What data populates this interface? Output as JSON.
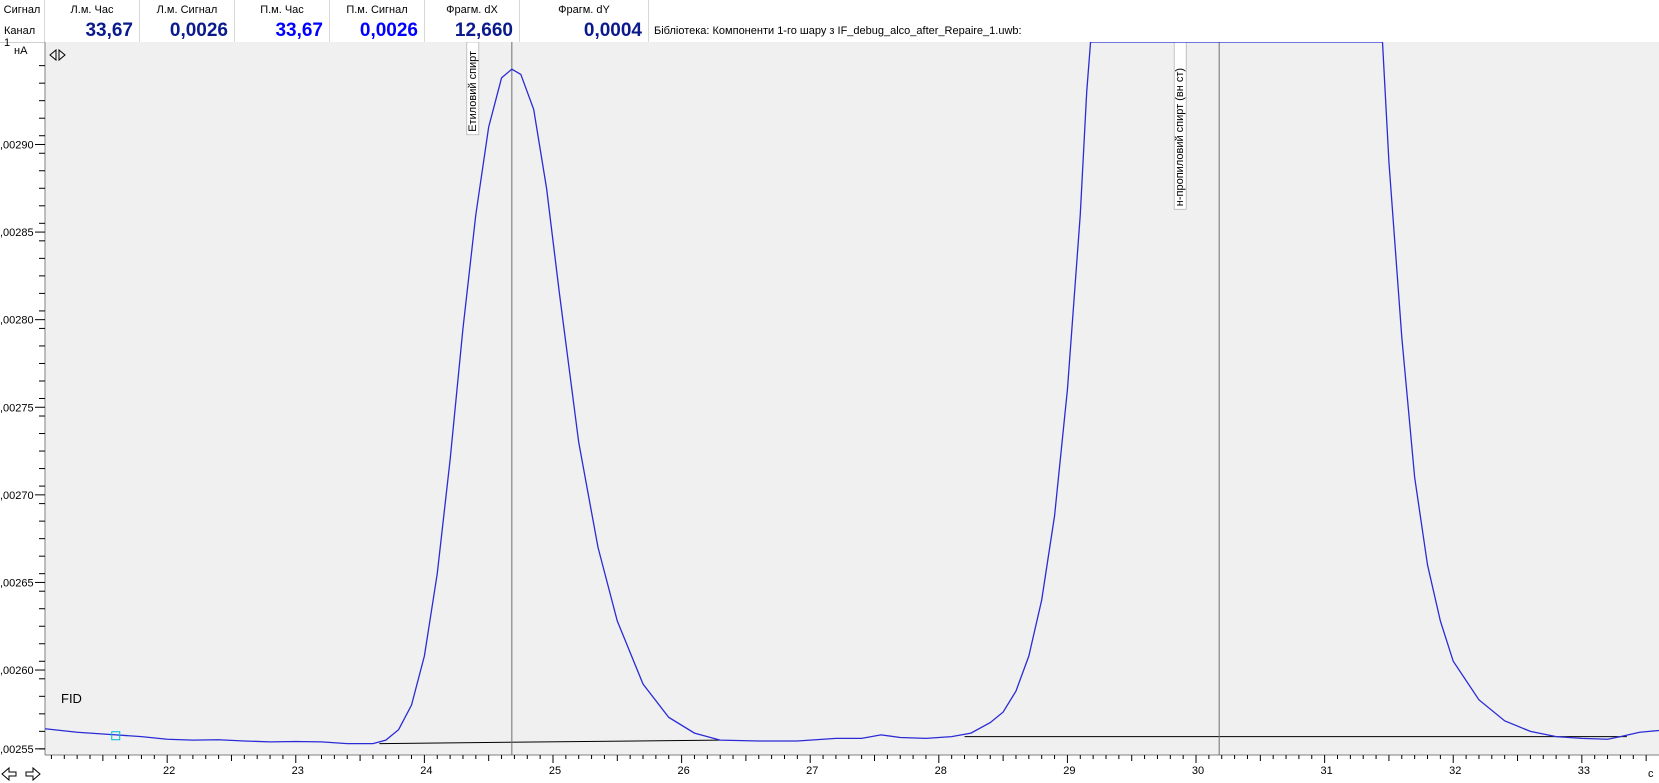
{
  "header": {
    "col0_label": "Сигнал",
    "channel": "Канал 1",
    "cols": [
      {
        "label": "Л.м. Час",
        "value": "33,67",
        "color": "#0a1a8c"
      },
      {
        "label": "Л.м. Сигнал",
        "value": "0,0026",
        "color": "#0a1a8c"
      },
      {
        "label": "П.м. Час",
        "value": "33,67",
        "color": "#0000ff"
      },
      {
        "label": "П.м. Сигнал",
        "value": "0,0026",
        "color": "#0000ff"
      },
      {
        "label": "Фрагм. dX",
        "value": "12,660",
        "color": "#0a1a8c"
      },
      {
        "label": "Фрагм. dY",
        "value": "0,0004",
        "color": "#0a1a8c"
      }
    ],
    "library": "Бібліотека: Компоненти 1-го шару з IF_debug_alco_after_Repaire_1.uwb:"
  },
  "chart_data": {
    "type": "line",
    "ylabel": "нА",
    "xlabel": "с",
    "detector": "FID",
    "xlim": [
      21.05,
      33.6
    ],
    "ylim": [
      2.5515,
      2.9585
    ],
    "x_ticks": [
      22,
      23,
      24,
      25,
      26,
      27,
      28,
      29,
      30,
      31,
      32,
      33
    ],
    "x_tick_labels": [
      "22",
      "23",
      "24",
      "25",
      "26",
      "27",
      "28",
      "29",
      "30",
      "31",
      "32",
      "33"
    ],
    "y_ticks": [
      2.555,
      2.6,
      2.65,
      2.7,
      2.75,
      2.8,
      2.85,
      2.9
    ],
    "y_tick_labels": [
      ",00255",
      ",00260",
      ",00265",
      ",00270",
      ",00275",
      ",00280",
      ",00285",
      ",00290"
    ],
    "series": [
      {
        "color": "#2b2bd6",
        "points": [
          [
            21.05,
            2.5665
          ],
          [
            21.3,
            2.5645
          ],
          [
            21.6,
            2.563
          ],
          [
            21.8,
            2.562
          ],
          [
            22.0,
            2.5605
          ],
          [
            22.2,
            2.56
          ],
          [
            22.4,
            2.5602
          ],
          [
            22.6,
            2.5595
          ],
          [
            22.8,
            2.559
          ],
          [
            23.0,
            2.5592
          ],
          [
            23.2,
            2.559
          ],
          [
            23.4,
            2.558
          ],
          [
            23.6,
            2.558
          ],
          [
            23.7,
            2.56
          ],
          [
            23.8,
            2.566
          ],
          [
            23.9,
            2.58
          ],
          [
            24.0,
            2.608
          ],
          [
            24.1,
            2.655
          ],
          [
            24.2,
            2.72
          ],
          [
            24.3,
            2.795
          ],
          [
            24.4,
            2.86
          ],
          [
            24.5,
            2.91
          ],
          [
            24.6,
            2.938
          ],
          [
            24.68,
            2.943
          ],
          [
            24.75,
            2.94
          ],
          [
            24.85,
            2.92
          ],
          [
            24.95,
            2.875
          ],
          [
            25.05,
            2.815
          ],
          [
            25.2,
            2.73
          ],
          [
            25.35,
            2.67
          ],
          [
            25.5,
            2.628
          ],
          [
            25.7,
            2.592
          ],
          [
            25.9,
            2.573
          ],
          [
            26.1,
            2.564
          ],
          [
            26.3,
            2.56
          ],
          [
            26.6,
            2.5595
          ],
          [
            26.9,
            2.5595
          ],
          [
            27.2,
            2.561
          ],
          [
            27.4,
            2.561
          ],
          [
            27.55,
            2.563
          ],
          [
            27.7,
            2.5615
          ],
          [
            27.9,
            2.561
          ],
          [
            28.1,
            2.562
          ],
          [
            28.25,
            2.564
          ],
          [
            28.4,
            2.57
          ],
          [
            28.5,
            2.576
          ],
          [
            28.6,
            2.588
          ],
          [
            28.7,
            2.608
          ],
          [
            28.8,
            2.64
          ],
          [
            28.9,
            2.688
          ],
          [
            29.0,
            2.76
          ],
          [
            29.1,
            2.86
          ],
          [
            29.15,
            2.93
          ],
          [
            29.18,
            2.9585
          ],
          [
            31.45,
            2.9585
          ],
          [
            31.5,
            2.89
          ],
          [
            31.6,
            2.79
          ],
          [
            31.7,
            2.71
          ],
          [
            31.8,
            2.66
          ],
          [
            31.9,
            2.628
          ],
          [
            32.0,
            2.605
          ],
          [
            32.2,
            2.583
          ],
          [
            32.4,
            2.571
          ],
          [
            32.6,
            2.565
          ],
          [
            32.8,
            2.562
          ],
          [
            33.0,
            2.561
          ],
          [
            33.2,
            2.5605
          ],
          [
            33.3,
            2.562
          ],
          [
            33.45,
            2.5645
          ],
          [
            33.6,
            2.5655
          ]
        ]
      }
    ],
    "baselines": [
      [
        [
          23.65,
          2.558
        ],
        [
          26.3,
          2.56
        ]
      ],
      [
        [
          28.2,
          2.562
        ],
        [
          33.35,
          2.562
        ]
      ]
    ],
    "peaks": [
      {
        "x": 24.68,
        "label": "Етиловий спирт"
      },
      {
        "x": 30.18,
        "label": "н-пропиловий спирт (вн ст)"
      }
    ],
    "marker": {
      "x": 21.6,
      "y": 2.5625,
      "color": "#00bcd4"
    },
    "grid": false
  }
}
